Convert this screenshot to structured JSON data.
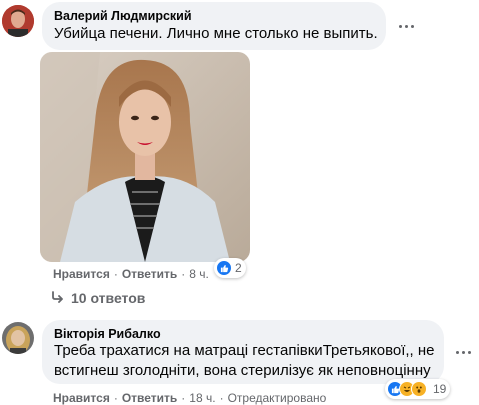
{
  "comments": [
    {
      "author": "Валерий Людмирский",
      "text": "Убийца печени. Лично мне столько не выпить.",
      "like": "Нравится",
      "reply": "Ответить",
      "time": "8 ч.",
      "reaction_count": "2",
      "replies_label": "10 ответов"
    },
    {
      "author": "Вікторія Рибалко",
      "text_line1": "Треба трахатися на матраці гестапівкиТретьякової,, не",
      "text_line2": "встигнеш зголодніти, вона стерилізує як неповноцінну",
      "like": "Нравится",
      "reply": "Ответить",
      "time": "18 ч.",
      "edited": "Отредактировано",
      "reaction_count": "19"
    }
  ],
  "colors": {
    "bubble": "#f0f2f5",
    "meta": "#65676b",
    "like_blue": "#1877f2"
  }
}
